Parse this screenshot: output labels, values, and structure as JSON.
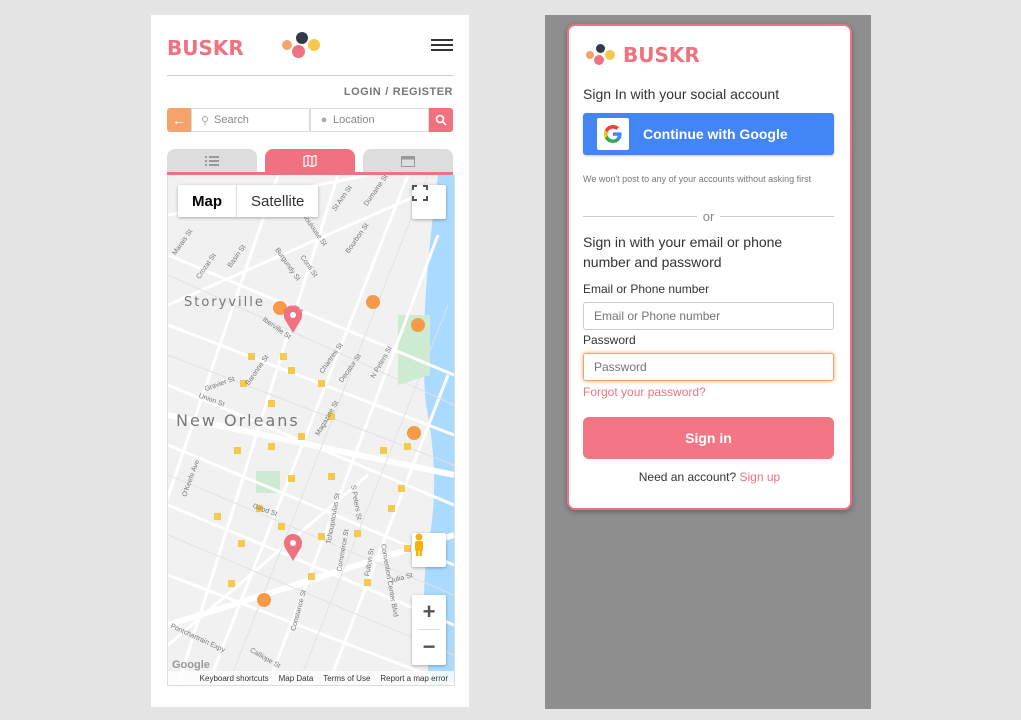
{
  "left_app": {
    "brand": "BUSKR",
    "auth": {
      "login": "LOGIN",
      "sep": "/",
      "register": "REGISTER"
    },
    "search": {
      "placeholder": "Search",
      "location_placeholder": "Location"
    },
    "tabs": [
      {
        "name": "list-icon"
      },
      {
        "name": "map-icon"
      },
      {
        "name": "calendar-icon"
      }
    ],
    "map": {
      "type_buttons": {
        "map": "Map",
        "satellite": "Satellite"
      },
      "labels": {
        "storyville": "Storyville",
        "new_orleans": "New Orleans"
      },
      "streets": [
        "Dumaine St",
        "St Ann St",
        "Toulouse St",
        "Bourbon St",
        "Conti St",
        "Burgundy St",
        "Crozat St",
        "Basin St",
        "Marais St",
        "Iberville St",
        "Baronne St",
        "Chartres St",
        "Decatur St",
        "N Peters St",
        "Gravier St",
        "Union St",
        "Magazine St",
        "O'Keefe Ave",
        "Girod St",
        "Tchoupitoulas St",
        "S Peters St",
        "Commerce St",
        "Convention Center Blvd",
        "Fulton St",
        "Julia St",
        "Constance St",
        "Calliope St",
        "Pontchartrain Expy"
      ],
      "footer": {
        "shortcuts": "Keyboard shortcuts",
        "data": "Map Data",
        "terms": "Terms of Use",
        "report": "Report a map error"
      },
      "zoom": {
        "in": "+",
        "out": "−"
      },
      "google_logo": "Google"
    },
    "colors": {
      "brand": "#f0717f",
      "accent": "#f6a36b"
    }
  },
  "modal": {
    "brand": "BUSKR",
    "social_heading": "Sign In with your social account",
    "google_button": "Continue with Google",
    "note": "We won't post to any of your accounts without asking first",
    "or": "or",
    "email_heading": "Sign in with your email or phone number and password",
    "email_label": "Email or Phone number",
    "email_placeholder": "Email or Phone number",
    "password_label": "Password",
    "password_placeholder": "Password",
    "forgot": "Forgot your password?",
    "signin": "Sign in",
    "need_account": "Need an account?",
    "signup": "Sign up"
  }
}
